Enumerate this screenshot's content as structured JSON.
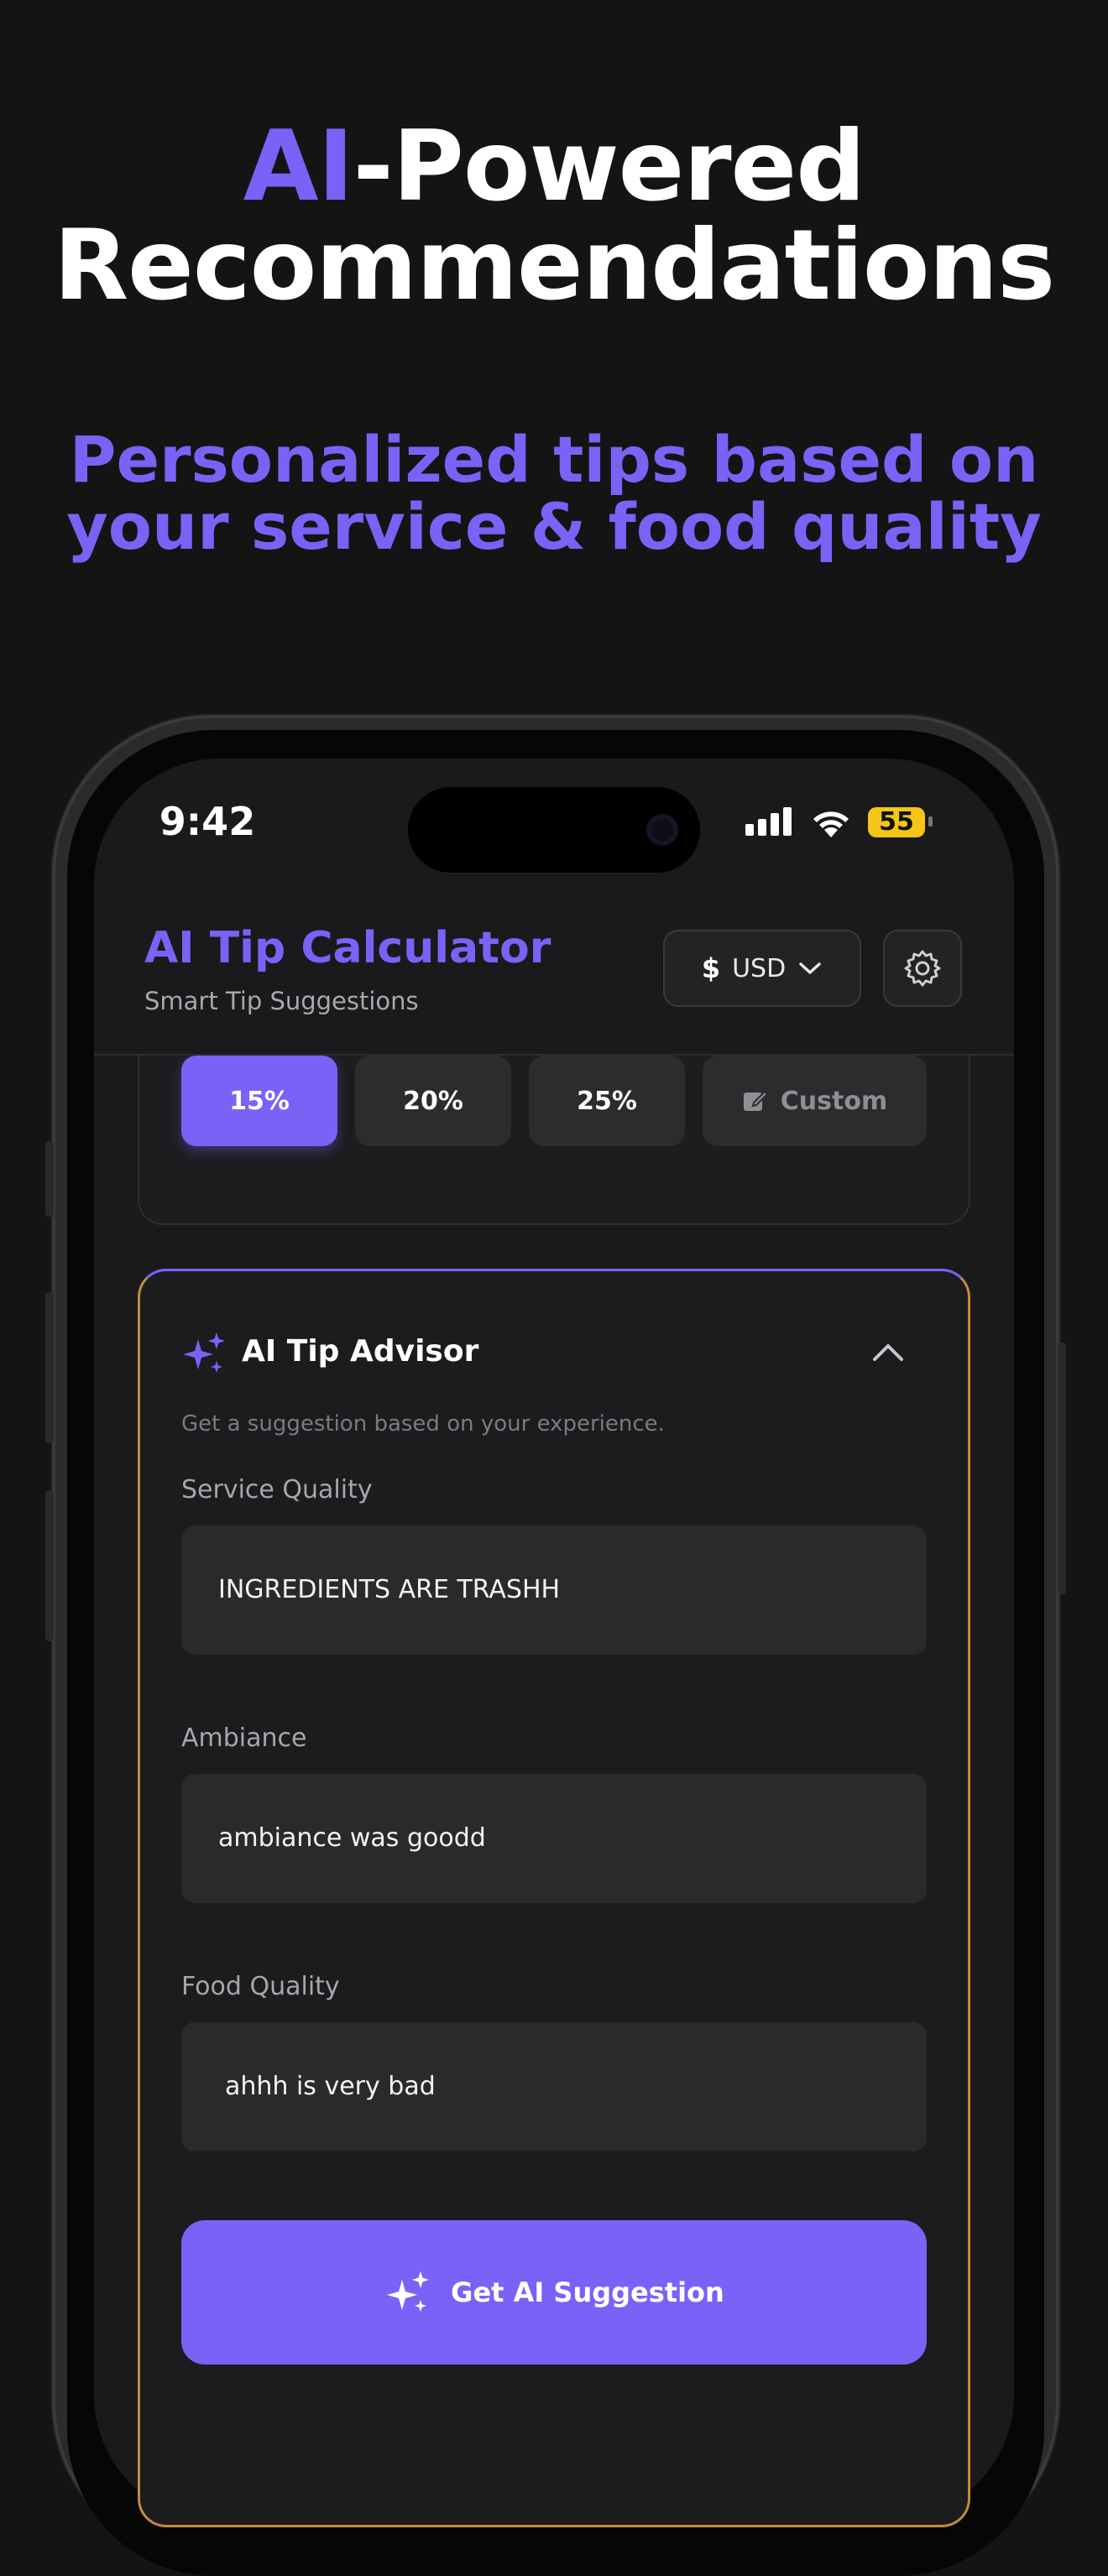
{
  "hero": {
    "title_accent": "AI",
    "title_rest": "-Powered",
    "title_line2": "Recommendations",
    "subtitle_line1": "Personalized tips based on",
    "subtitle_line2": "your service & food quality"
  },
  "status_bar": {
    "time": "9:42",
    "battery": "55"
  },
  "header": {
    "title": "AI Tip Calculator",
    "subtitle": "Smart Tip Suggestions",
    "currency_symbol": "$",
    "currency": "USD"
  },
  "tip_options": [
    {
      "label": "15%",
      "selected": true
    },
    {
      "label": "20%",
      "selected": false
    },
    {
      "label": "25%",
      "selected": false
    },
    {
      "label": "Custom",
      "selected": false
    }
  ],
  "advisor": {
    "title": "AI Tip Advisor",
    "description": "Get a suggestion based on your experience.",
    "fields": [
      {
        "label": "Service Quality",
        "value": "INGREDIENTS  ARE TRASHH"
      },
      {
        "label": "Ambiance",
        "value": "ambiance was goodd"
      },
      {
        "label": "Food Quality",
        "value": "ahhh is very bad"
      }
    ],
    "button_label": "Get AI Suggestion"
  },
  "colors": {
    "accent": "#7a62f6",
    "background": "#141414",
    "card_border_gold": "#c48a3a",
    "battery": "#f5c518"
  }
}
